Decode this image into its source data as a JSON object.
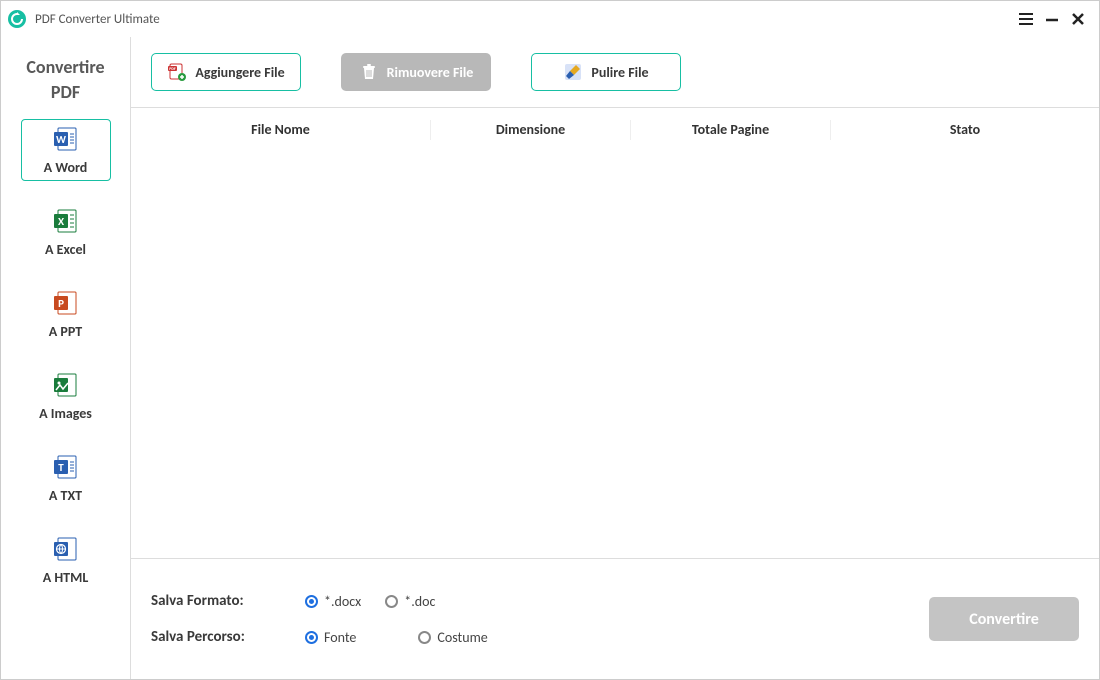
{
  "app": {
    "title": "PDF Converter Ultimate"
  },
  "sidebar": {
    "title_line1": "Convertire",
    "title_line2": "PDF",
    "items": [
      {
        "label": "A Word",
        "selected": true
      },
      {
        "label": "A Excel",
        "selected": false
      },
      {
        "label": "A PPT",
        "selected": false
      },
      {
        "label": "A Images",
        "selected": false
      },
      {
        "label": "A TXT",
        "selected": false
      },
      {
        "label": "A HTML",
        "selected": false
      }
    ]
  },
  "toolbar": {
    "add": {
      "label": "Aggiungere File"
    },
    "remove": {
      "label": "Rimuovere File"
    },
    "clear": {
      "label": "Pulire File"
    }
  },
  "table": {
    "columns": {
      "name": "File Nome",
      "size": "Dimensione",
      "pages": "Totale Pagine",
      "status": "Stato"
    },
    "rows": []
  },
  "bottom": {
    "format_label": "Salva Formato:",
    "format_options": [
      {
        "label": "*.docx",
        "checked": true
      },
      {
        "label": "*.doc",
        "checked": false
      }
    ],
    "path_label": "Salva Percorso:",
    "path_options": [
      {
        "label": "Fonte",
        "checked": true
      },
      {
        "label": "Costume",
        "checked": false
      }
    ],
    "convert_label": "Convertire"
  }
}
